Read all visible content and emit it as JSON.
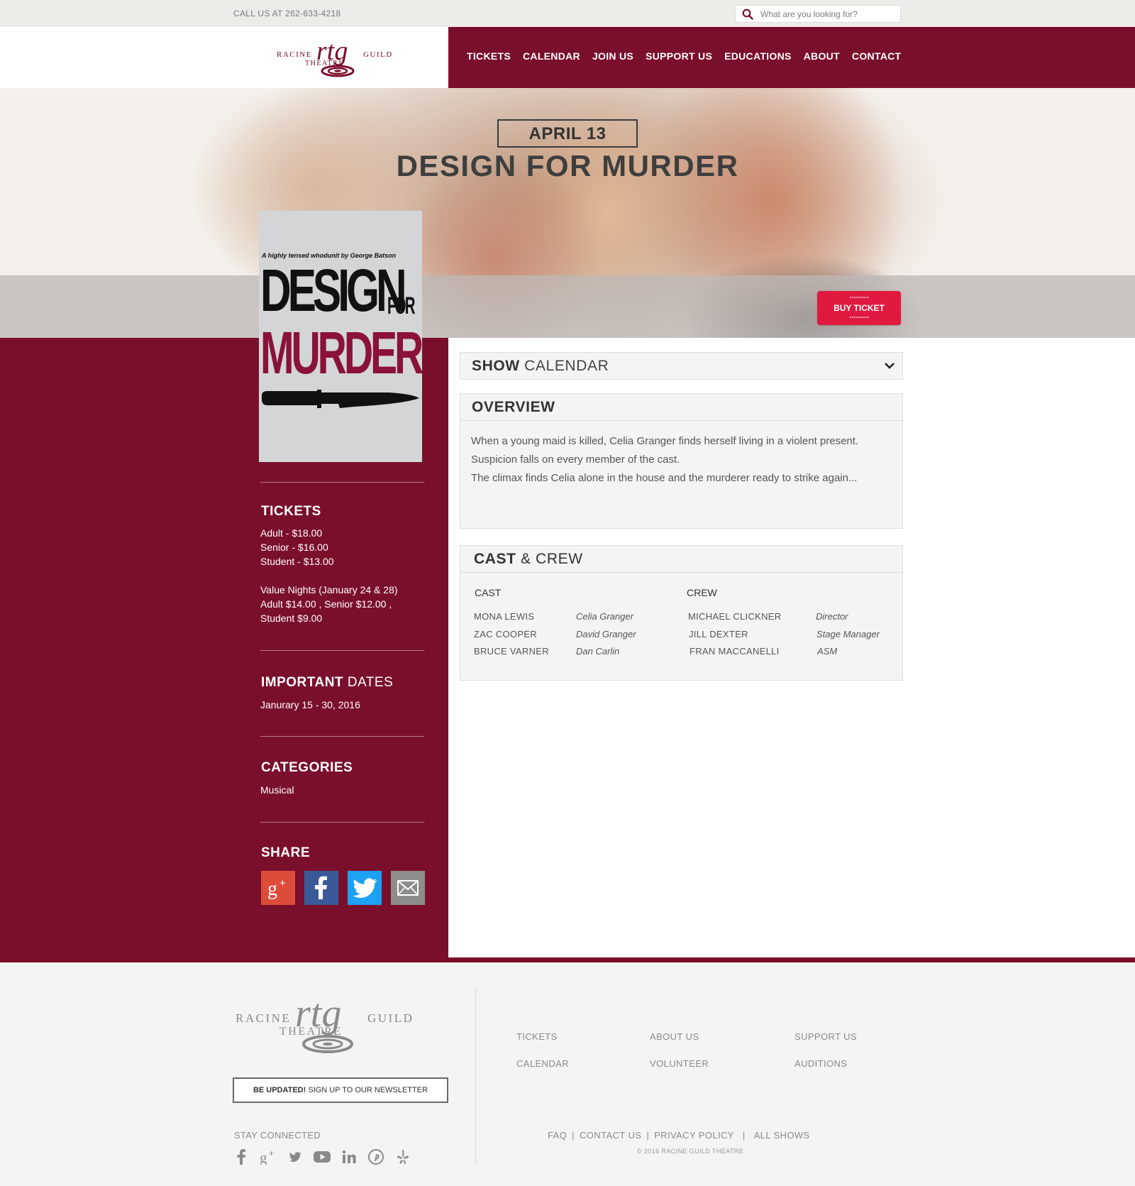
{
  "topbar": {
    "phone": "CALL US AT 262-633-4218",
    "search_placeholder": "What are you looking for?"
  },
  "brand": {
    "name_left": "RACINE",
    "name_right": "GUILD",
    "name_bottom": "THEATRE",
    "monogram": "rtg"
  },
  "nav": {
    "items": [
      "TICKETS",
      "CALENDAR",
      "JOIN US",
      "SUPPORT US",
      "EDUCATIONS",
      "ABOUT",
      "CONTACT"
    ]
  },
  "hero": {
    "date": "APRIL 13",
    "title": "DESIGN FOR MURDER",
    "buy_ticket": "BUY TICKET"
  },
  "poster": {
    "tagline": "A highly tensed whodunit by George Batson",
    "line1": "DESIGN",
    "line1_small": "FOR",
    "line2": "MURDER"
  },
  "sidebar": {
    "tickets": {
      "heading": "TICKETS",
      "lines": [
        "Adult - $18.00",
        "Senior - $16.00",
        "Student - $13.00"
      ],
      "value_lines": [
        "Value Nights (January 24 & 28)",
        "Adult $14.00 , Senior $12.00 ,",
        "Student $9.00"
      ]
    },
    "dates": {
      "heading_bold": "IMPORTANT",
      "heading_light": "DATES",
      "value": "Janurary 15 - 30, 2016"
    },
    "categories": {
      "heading": "CATEGORIES",
      "value": "Musical"
    },
    "share": {
      "heading": "SHARE",
      "icons": [
        "google-plus-icon",
        "facebook-icon",
        "twitter-icon",
        "email-icon"
      ]
    }
  },
  "calendar": {
    "label_bold": "SHOW",
    "label_light": "CALENDAR"
  },
  "overview": {
    "heading": "OVERVIEW",
    "paragraphs": [
      "When a young maid is killed, Celia Granger finds herself living in a violent present.",
      "Suspicion falls on every member of the cast.",
      "The climax finds Celia alone in the house and the murderer ready to strike again..."
    ]
  },
  "cast_crew": {
    "heading_bold": "CAST",
    "heading_light": "& CREW",
    "cast_label": "CAST",
    "crew_label": "CREW",
    "cast": [
      {
        "name": "MONA LEWIS",
        "role": "Celia Granger"
      },
      {
        "name": "ZAC COOPER",
        "role": "David Granger"
      },
      {
        "name": "BRUCE VARNER",
        "role": "Dan Carlin"
      }
    ],
    "crew": [
      {
        "name": "MICHAEL CLICKNER",
        "role": "Director"
      },
      {
        "name": "JILL DEXTER",
        "role": "Stage Manager"
      },
      {
        "name": "FRAN MACCANELLI",
        "role": "ASM"
      }
    ]
  },
  "footer": {
    "newsletter_bold": "BE UPDATED!",
    "newsletter_text": "SIGN UP TO OUR NEWSLETTER",
    "stay_connected": "STAY CONNECTED",
    "social_icons": [
      "facebook-icon",
      "google-plus-icon",
      "twitter-icon",
      "youtube-icon",
      "linkedin-icon",
      "pinterest-icon",
      "yelp-icon"
    ],
    "links": [
      "TICKETS",
      "ABOUT US",
      "SUPPORT US",
      "CALENDAR",
      "VOLUNTEER",
      "AUDITIONS"
    ],
    "bottom_links": [
      "FAQ",
      "CONTACT US",
      "PRIVACY POLICY",
      "ALL SHOWS"
    ],
    "copyright": "© 2016 RACINE GUILD THEATRE"
  },
  "colors": {
    "brand": "#7a0f2c",
    "buy_ticket": "#e01940",
    "google_plus": "#dd4b39",
    "facebook": "#3b5998",
    "twitter": "#1da1f2",
    "email": "#8d8d8d"
  }
}
